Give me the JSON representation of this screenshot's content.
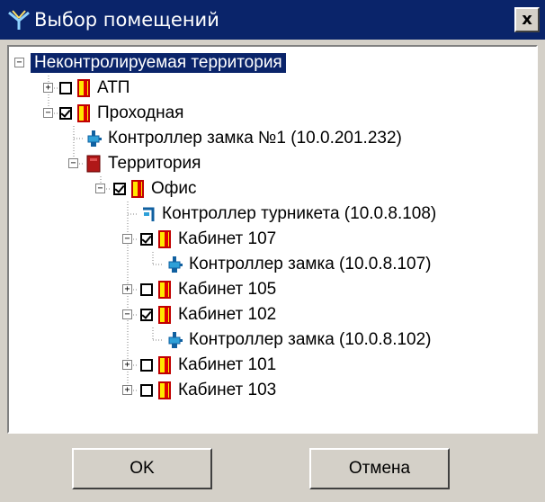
{
  "window": {
    "title": "Выбор помещений",
    "close_label": "x"
  },
  "tree": [
    {
      "label": "Неконтролируемая территория"
    },
    {
      "label": "АТП"
    },
    {
      "label": "Проходная"
    },
    {
      "label": "Контроллер замка №1 (10.0.201.232)"
    },
    {
      "label": "Территория"
    },
    {
      "label": "Офис"
    },
    {
      "label": "Контроллер турникета (10.0.8.108)"
    },
    {
      "label": "Кабинет 107"
    },
    {
      "label": "Контроллер замка (10.0.8.107)"
    },
    {
      "label": "Кабинет 105"
    },
    {
      "label": "Кабинет 102"
    },
    {
      "label": "Контроллер замка (10.0.8.102)"
    },
    {
      "label": "Кабинет 101"
    },
    {
      "label": "Кабинет 103"
    }
  ],
  "buttons": {
    "ok": "OK",
    "cancel": "Отмена"
  }
}
